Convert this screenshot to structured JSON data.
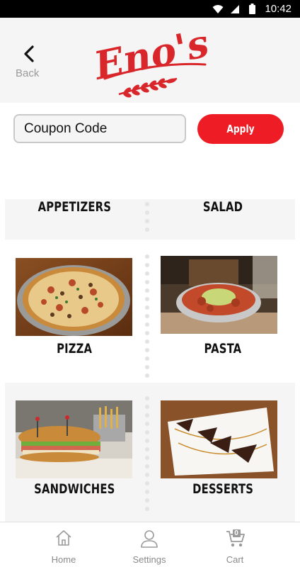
{
  "status_bar": {
    "time": "10:42"
  },
  "header": {
    "back_label": "Back",
    "logo_text": "Eno's"
  },
  "coupon": {
    "placeholder": "Coupon Code",
    "apply_label": "Apply"
  },
  "menu": {
    "categories": [
      {
        "label": "APPETIZERS"
      },
      {
        "label": "SALAD"
      },
      {
        "label": "PIZZA"
      },
      {
        "label": "PASTA"
      },
      {
        "label": "SANDWICHES"
      },
      {
        "label": "DESSERTS"
      }
    ]
  },
  "bottom_nav": {
    "items": [
      {
        "label": "Home",
        "icon": "home-icon"
      },
      {
        "label": "Settings",
        "icon": "user-icon"
      },
      {
        "label": "Cart",
        "icon": "cart-icon",
        "badge": "0"
      }
    ]
  },
  "colors": {
    "accent": "#ee1c24",
    "logo_red": "#d9262b",
    "tile_bg": "#f5f5f5"
  }
}
